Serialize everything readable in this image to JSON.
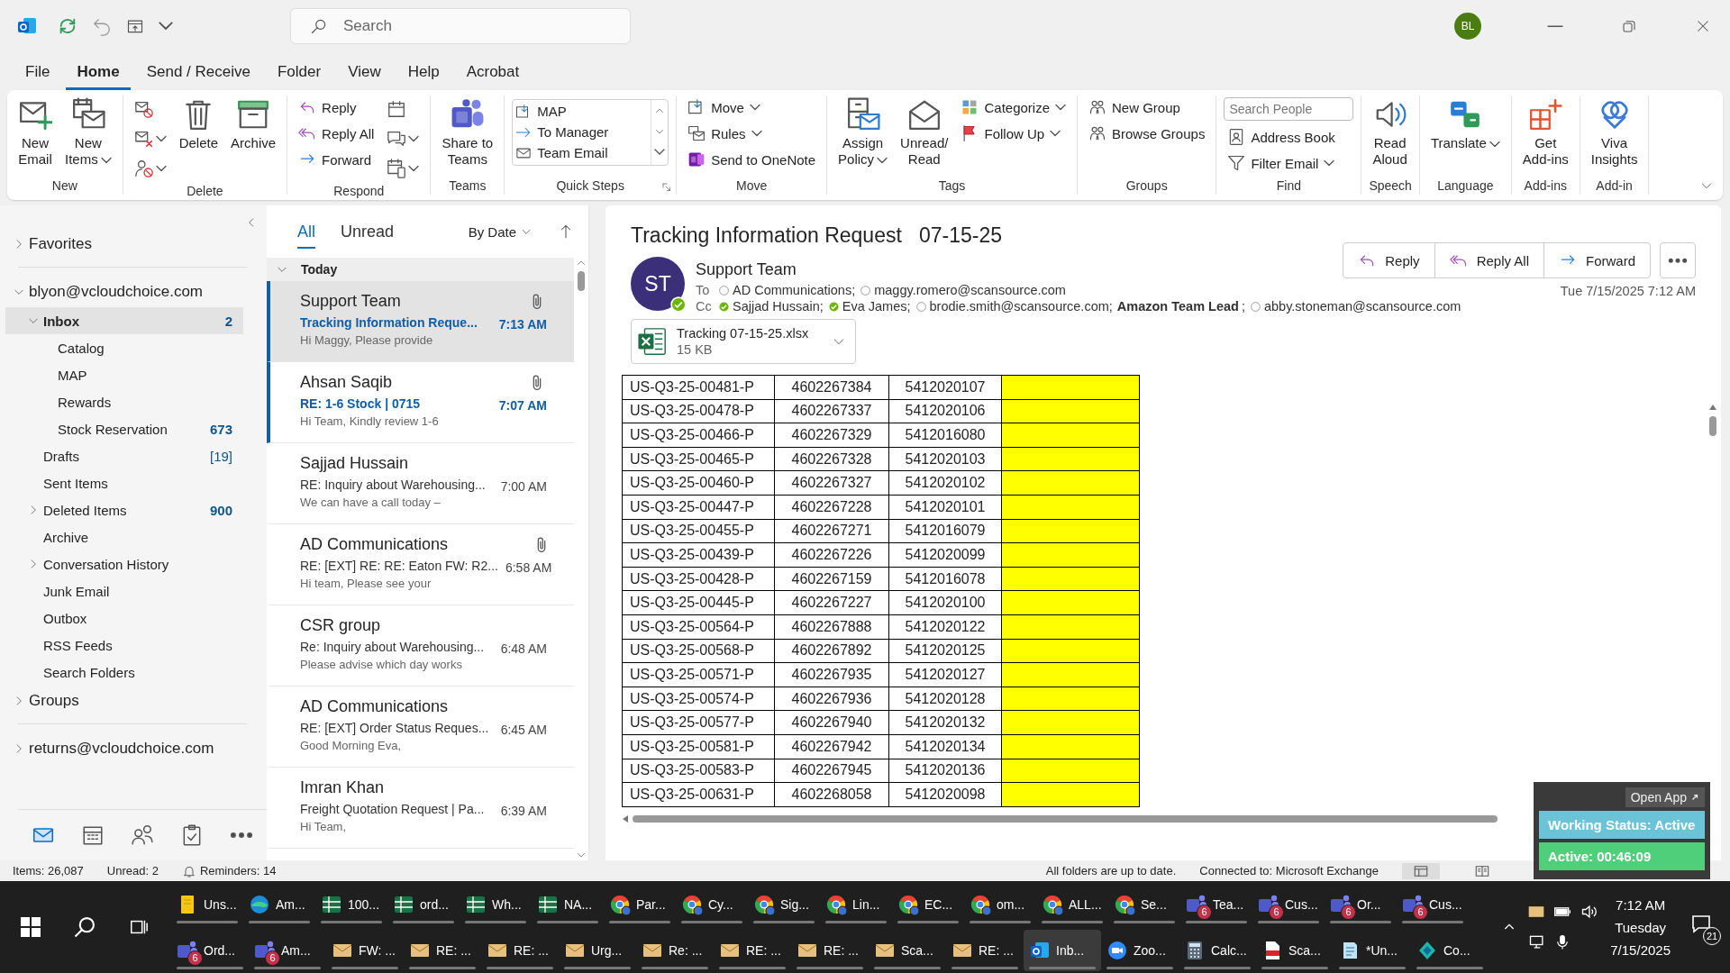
{
  "title_bar": {
    "search": {
      "placeholder": "Search"
    },
    "avatar": "BL"
  },
  "menu_tabs": [
    {
      "label": "File",
      "selected": false
    },
    {
      "label": "Home",
      "selected": true
    },
    {
      "label": "Send / Receive",
      "selected": false
    },
    {
      "label": "Folder",
      "selected": false
    },
    {
      "label": "View",
      "selected": false
    },
    {
      "label": "Help",
      "selected": false
    },
    {
      "label": "Acrobat",
      "selected": false
    }
  ],
  "ribbon": {
    "groups": [
      {
        "label": "New",
        "columns": [
          [
            {
              "kind": "large",
              "label": "New\nEmail",
              "dropdown": false
            }
          ],
          [
            {
              "kind": "large",
              "label": "New\nItems",
              "dropdown": true
            }
          ]
        ]
      },
      {
        "label": "Delete",
        "columns": [
          [
            {
              "kind": "icon",
              "dropdown": false
            },
            {
              "kind": "icon",
              "dropdown": true
            },
            {
              "kind": "icon",
              "dropdown": true
            }
          ],
          [
            {
              "kind": "large",
              "label": "Delete",
              "dropdown": false
            }
          ],
          [
            {
              "kind": "large",
              "label": "Archive",
              "dropdown": false
            }
          ]
        ]
      },
      {
        "label": "Respond",
        "columns": [
          [
            {
              "kind": "small",
              "label": "Reply",
              "dropdown": false
            },
            {
              "kind": "small",
              "label": "Reply All",
              "dropdown": false
            },
            {
              "kind": "small",
              "label": "Forward",
              "dropdown": false
            }
          ],
          [
            {
              "kind": "icon",
              "dropdown": false
            },
            {
              "kind": "icon",
              "dropdown": true
            },
            {
              "kind": "icon",
              "dropdown": true
            }
          ]
        ]
      },
      {
        "label": "Teams",
        "columns": [
          [
            {
              "kind": "large",
              "label": "Share to\nTeams",
              "dropdown": false
            }
          ]
        ]
      },
      {
        "label": "Quick Steps",
        "launcher": true,
        "columns": [
          [
            {
              "kind": "quick_steps",
              "steps": [
                "MAP",
                "To Manager",
                "Team Email"
              ]
            }
          ]
        ]
      },
      {
        "label": "Move",
        "columns": [
          [
            {
              "kind": "small",
              "label": "Move",
              "dropdown": true
            },
            {
              "kind": "small",
              "label": "Rules",
              "dropdown": true
            },
            {
              "kind": "small",
              "label": "Send to OneNote",
              "dropdown": false
            }
          ]
        ]
      },
      {
        "label": "Tags",
        "columns": [
          [
            {
              "kind": "large",
              "label": "Assign\nPolicy",
              "dropdown": true
            }
          ],
          [
            {
              "kind": "large",
              "label": "Unread/\nRead",
              "dropdown": false
            }
          ],
          [
            {
              "kind": "small",
              "label": "Categorize",
              "dropdown": true
            },
            {
              "kind": "small",
              "label": "Follow Up",
              "dropdown": true
            }
          ]
        ]
      },
      {
        "label": "Groups",
        "columns": [
          [
            {
              "kind": "small",
              "label": "New Group",
              "dropdown": false
            },
            {
              "kind": "small",
              "label": "Browse Groups",
              "dropdown": false
            }
          ]
        ]
      },
      {
        "label": "Find",
        "columns": [
          [
            {
              "kind": "search",
              "placeholder": "Search People"
            },
            {
              "kind": "small",
              "label": "Address Book",
              "dropdown": false
            },
            {
              "kind": "small",
              "label": "Filter Email",
              "dropdown": true
            }
          ]
        ]
      },
      {
        "label": "Speech",
        "columns": [
          [
            {
              "kind": "large",
              "label": "Read\nAloud",
              "dropdown": false
            }
          ]
        ]
      },
      {
        "label": "Language",
        "columns": [
          [
            {
              "kind": "large",
              "label": "Translate",
              "dropdown": true
            }
          ]
        ]
      },
      {
        "label": "Add-ins",
        "columns": [
          [
            {
              "kind": "large",
              "label": "Get\nAdd-ins",
              "dropdown": false
            }
          ]
        ]
      },
      {
        "label": "Add-in",
        "columns": [
          [
            {
              "kind": "large",
              "label": "Viva\nInsights",
              "dropdown": false
            }
          ]
        ]
      }
    ]
  },
  "folders": [
    {
      "label": "Favorites",
      "kind": "section",
      "expanded": false
    },
    {
      "label": "blyon@vcloudchoice.com",
      "kind": "account",
      "expanded": true,
      "children": [
        {
          "label": "Inbox",
          "selected": true,
          "expanded": true,
          "count": "2",
          "count_bold": true,
          "children": [
            {
              "label": "Catalog",
              "selected": false
            },
            {
              "label": "MAP",
              "selected": false
            },
            {
              "label": "Rewards",
              "selected": false
            },
            {
              "label": "Stock Reservation",
              "selected": false,
              "count": "673",
              "count_bold": true
            }
          ]
        },
        {
          "label": "Drafts",
          "selected": false,
          "count": "[19]",
          "count_bold": false
        },
        {
          "label": "Sent Items",
          "selected": false
        },
        {
          "label": "Deleted Items",
          "selected": false,
          "expanded": false,
          "count": "900",
          "count_bold": true
        },
        {
          "label": "Archive",
          "selected": false
        },
        {
          "label": "Conversation History",
          "selected": false,
          "expanded": false
        },
        {
          "label": "Junk Email",
          "selected": false
        },
        {
          "label": "Outbox",
          "selected": false
        },
        {
          "label": "RSS Feeds",
          "selected": false
        },
        {
          "label": "Search Folders",
          "selected": false
        }
      ]
    },
    {
      "label": "Groups",
      "kind": "section",
      "expanded": false
    },
    {
      "label": "returns@vcloudchoice.com",
      "kind": "account",
      "expanded": false
    }
  ],
  "nav_bar": [
    {
      "kind": "mail",
      "selected": true
    },
    {
      "kind": "calendar",
      "selected": false
    },
    {
      "kind": "people",
      "selected": false
    },
    {
      "kind": "tasks",
      "selected": false
    },
    {
      "kind": "more",
      "selected": false
    }
  ],
  "message_list": {
    "filters": [
      {
        "label": "All",
        "selected": true
      },
      {
        "label": "Unread",
        "selected": false
      }
    ],
    "sort": "By Date",
    "group": {
      "label": "Today",
      "expanded": true
    },
    "messages": [
      {
        "sender": "Support Team",
        "subject": "Tracking Information Reque...",
        "preview": "Hi Maggy,  Please provide",
        "time": "7:13 AM",
        "attachment": true,
        "unread": true,
        "selected": true
      },
      {
        "sender": "Ahsan Saqib",
        "subject": "RE: 1-6 Stock | 0715",
        "preview": "Hi Team,  Kindly review 1-6",
        "time": "7:07 AM",
        "attachment": true,
        "unread": true,
        "selected": false
      },
      {
        "sender": "Sajjad Hussain",
        "subject": "RE: Inquiry about Warehousing...",
        "preview": "We can have a call today –",
        "time": "7:00 AM",
        "attachment": false,
        "unread": false,
        "selected": false
      },
      {
        "sender": "AD Communications",
        "subject": "RE: [EXT] RE: RE: Eaton FW: R2...",
        "preview": "Hi team,   Please see your",
        "time": "6:58 AM",
        "attachment": true,
        "unread": false,
        "selected": false
      },
      {
        "sender": "CSR group",
        "subject": "Re: Inquiry about Warehousing...",
        "preview": "Please advise which day works",
        "time": "6:48 AM",
        "attachment": false,
        "unread": false,
        "selected": false
      },
      {
        "sender": "AD Communications",
        "subject": "RE: [EXT] Order Status Reques...",
        "preview": "Good Morning Eva,",
        "time": "6:45 AM",
        "attachment": false,
        "unread": false,
        "selected": false
      },
      {
        "sender": "Imran Khan",
        "subject": "Freight Quotation Request | Pa...",
        "preview": "Hi Team,",
        "time": "6:39 AM",
        "attachment": false,
        "unread": false,
        "selected": false
      }
    ]
  },
  "message": {
    "subject": "Tracking Information Request   07-15-25",
    "sender": {
      "initials": "ST",
      "name": "Support Team",
      "available": true
    },
    "to_label": "To",
    "to": [
      {
        "name": "AD Communications;",
        "kind": "unknown"
      },
      {
        "name": "maggy.romero@scansource.com",
        "kind": "unknown"
      }
    ],
    "cc_label": "Cc",
    "cc": [
      {
        "name": "Sajjad Hussain;",
        "kind": "available"
      },
      {
        "name": "Eva James;",
        "kind": "available"
      },
      {
        "name": "brodie.smith@scansource.com;",
        "kind": "unknown"
      },
      {
        "name": "**Amazon Team Lead**;",
        "kind": "plain"
      },
      {
        "name": "abby.stoneman@scansource.com",
        "kind": "unknown"
      }
    ],
    "date": "Tue 7/15/2025 7:12 AM",
    "actions": [
      {
        "kind": "reply",
        "label": "Reply"
      },
      {
        "kind": "reply_all",
        "label": "Reply All"
      },
      {
        "kind": "forward",
        "label": "Forward"
      },
      {
        "kind": "more"
      }
    ],
    "attachment": {
      "name": "Tracking 07-15-25.xlsx",
      "size": "15 KB"
    },
    "table": {
      "rows": [
        [
          "US-Q3-25-00481-P",
          "4602267384",
          "5412020107"
        ],
        [
          "US-Q3-25-00478-P",
          "4602267337",
          "5412020106"
        ],
        [
          "US-Q3-25-00466-P",
          "4602267329",
          "5412016080"
        ],
        [
          "US-Q3-25-00465-P",
          "4602267328",
          "5412020103"
        ],
        [
          "US-Q3-25-00460-P",
          "4602267327",
          "5412020102"
        ],
        [
          "US-Q3-25-00447-P",
          "4602267228",
          "5412020101"
        ],
        [
          "US-Q3-25-00455-P",
          "4602267271",
          "5412016079"
        ],
        [
          "US-Q3-25-00439-P",
          "4602267226",
          "5412020099"
        ],
        [
          "US-Q3-25-00428-P",
          "4602267159",
          "5412016078"
        ],
        [
          "US-Q3-25-00445-P",
          "4602267227",
          "5412020100"
        ],
        [
          "US-Q3-25-00564-P",
          "4602267888",
          "5412020122"
        ],
        [
          "US-Q3-25-00568-P",
          "4602267892",
          "5412020125"
        ],
        [
          "US-Q3-25-00571-P",
          "4602267935",
          "5412020127"
        ],
        [
          "US-Q3-25-00574-P",
          "4602267936",
          "5412020128"
        ],
        [
          "US-Q3-25-00577-P",
          "4602267940",
          "5412020132"
        ],
        [
          "US-Q3-25-00581-P",
          "4602267942",
          "5412020134"
        ],
        [
          "US-Q3-25-00583-P",
          "4602267945",
          "5412020136"
        ],
        [
          "US-Q3-25-00631-P",
          "4602268058",
          "5412020098"
        ]
      ]
    }
  },
  "status_bar": {
    "items": "Items: 26,087",
    "unread": "Unread: 2",
    "reminders": "Reminders: 14",
    "sync": "All folders are up to date.",
    "connection": "Connected to: Microsoft Exchange"
  },
  "tracker": {
    "open_app": "Open App",
    "status": "Working Status: Active",
    "timer": "Active: 00:46:09"
  },
  "taskbar": {
    "upper_row": [
      {
        "label": "Uns...",
        "kind": "notes",
        "selected": false
      },
      {
        "label": "Am...",
        "kind": "edge",
        "selected": false
      },
      {
        "label": "100...",
        "kind": "excel",
        "selected": false
      },
      {
        "label": "ord...",
        "kind": "excel",
        "selected": false
      },
      {
        "label": "Wh...",
        "kind": "excel",
        "selected": false
      },
      {
        "label": "NA...",
        "kind": "excel",
        "selected": false
      },
      {
        "label": "Par...",
        "kind": "chrome",
        "selected": false
      },
      {
        "label": "Cy...",
        "kind": "chrome",
        "selected": false
      },
      {
        "label": "Sig...",
        "kind": "chrome",
        "selected": false
      },
      {
        "label": "Lin...",
        "kind": "chrome",
        "selected": false
      },
      {
        "label": "EC...",
        "kind": "chrome",
        "selected": false
      },
      {
        "label": "om...",
        "kind": "chrome",
        "selected": false
      },
      {
        "label": "ALL...",
        "kind": "chrome",
        "selected": false
      },
      {
        "label": "Se...",
        "kind": "chrome",
        "selected": false
      },
      {
        "label": "Tea...",
        "kind": "teams",
        "badge": "6",
        "selected": false
      },
      {
        "label": "Cus...",
        "kind": "teams",
        "badge": "6",
        "selected": false
      },
      {
        "label": "Or...",
        "kind": "teams",
        "badge": "6",
        "selected": false
      },
      {
        "label": "Cus...",
        "kind": "teams",
        "badge": "6",
        "selected": false
      }
    ],
    "lower_row": [
      {
        "label": "Ord...",
        "kind": "teams",
        "badge": "6",
        "selected": false
      },
      {
        "label": "Am...",
        "kind": "teams",
        "badge": "6",
        "selected": false
      },
      {
        "label": "FW: ...",
        "kind": "mail",
        "selected": false
      },
      {
        "label": "RE: ...",
        "kind": "mail",
        "selected": false
      },
      {
        "label": "RE: ...",
        "kind": "mail",
        "selected": false
      },
      {
        "label": "Urg...",
        "kind": "mail",
        "selected": false
      },
      {
        "label": "Re: ...",
        "kind": "mail",
        "selected": false
      },
      {
        "label": "RE: ...",
        "kind": "mail",
        "selected": false
      },
      {
        "label": "RE: ...",
        "kind": "mail",
        "selected": false
      },
      {
        "label": "Sca...",
        "kind": "mail",
        "selected": false
      },
      {
        "label": "RE: ...",
        "kind": "mail",
        "selected": false
      },
      {
        "label": "Inb...",
        "kind": "outlook",
        "selected": true
      },
      {
        "label": "Zoo...",
        "kind": "zoom",
        "selected": false
      },
      {
        "label": "Calc...",
        "kind": "calc",
        "selected": false
      },
      {
        "label": "Sca...",
        "kind": "pdf",
        "selected": false
      },
      {
        "label": "*Un...",
        "kind": "notepad",
        "selected": false
      },
      {
        "label": "Co...",
        "kind": "copilot",
        "selected": false
      }
    ],
    "clock": {
      "time": "7:12 AM",
      "day": "Tuesday",
      "date": "7/15/2025"
    },
    "notifications": "21"
  }
}
